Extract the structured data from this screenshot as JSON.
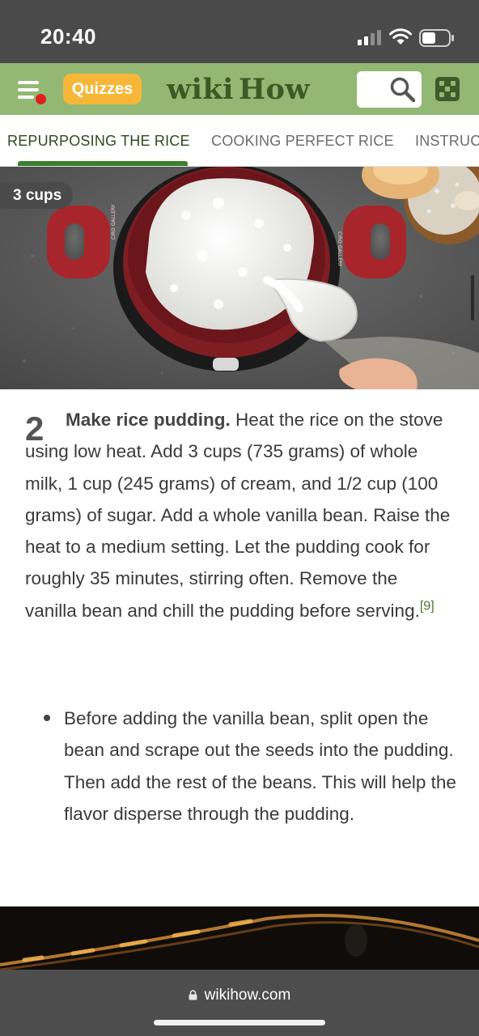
{
  "status_bar": {
    "time": "20:40"
  },
  "header": {
    "quizzes_label": "Quizzes",
    "logo_part1": "wiki",
    "logo_part2": "How",
    "brand_color": "#93b874",
    "quiz_color": "#f6b739",
    "menu_notification": true
  },
  "tabs": [
    {
      "label": "REPURPOSING THE RICE",
      "active": true
    },
    {
      "label": "COOKING PERFECT RICE",
      "active": false
    },
    {
      "label": "INSTRUC",
      "active": false
    }
  ],
  "image": {
    "badge": "3 cups",
    "pot_text": "CIRO GALLERY"
  },
  "step": {
    "number": "2",
    "title": "Make rice pudding.",
    "body": " Heat the rice on the stove using low heat. Add 3 cups (735 grams) of whole milk, 1 cup (245 grams) of cream, and 1/2 cup (100 grams) of sugar. Add a whole vanilla bean. Raise the heat to a medium setting. Let the pudding cook for roughly 35 minutes, stirring often. Remove the vanilla bean and chill the pudding before serving.",
    "citation": "[9]",
    "bullets": [
      "Before adding the vanilla bean, split open the bean and scrape out the seeds into the pudding. Then add the rest of the beans. This will help the flavor disperse through the pudding."
    ]
  },
  "browser": {
    "url": "wikihow.com"
  },
  "icons": {
    "menu": "hamburger-menu-icon",
    "search": "search-icon",
    "random": "dice-icon",
    "lock": "lock-icon",
    "signal": "cellular-signal-icon",
    "wifi": "wifi-icon",
    "battery": "battery-icon"
  }
}
